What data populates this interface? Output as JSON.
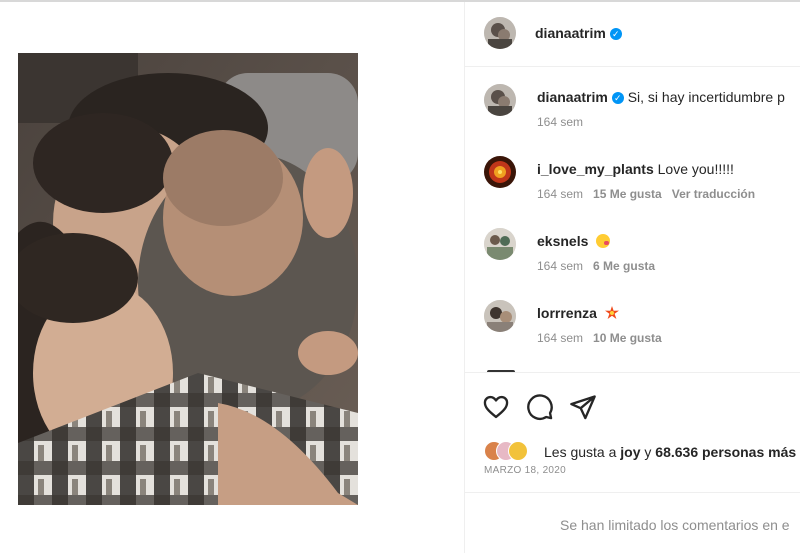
{
  "post": {
    "author": "dianaatrim",
    "verified": true
  },
  "comments": [
    {
      "user": "dianaatrim",
      "verified": true,
      "text": "Si, si hay incertidumbre p",
      "time": "164 sem",
      "likes": "",
      "translate": ""
    },
    {
      "user": "i_love_my_plants",
      "verified": false,
      "text": "Love you!!!!!",
      "time": "164 sem",
      "likes": "15 Me gusta",
      "translate": "Ver traducción"
    },
    {
      "user": "eksnels",
      "verified": false,
      "text": "",
      "emoji": "kiss-heart-emoji",
      "time": "164 sem",
      "likes": "6 Me gusta",
      "translate": ""
    },
    {
      "user": "lorrrenza",
      "verified": false,
      "text": "",
      "emoji": "sparkle-emoji",
      "time": "164 sem",
      "likes": "10 Me gusta",
      "translate": ""
    }
  ],
  "actions": {
    "like_icon": "heart-outline-icon",
    "comment_icon": "comment-bubble-icon",
    "share_icon": "paper-plane-icon"
  },
  "likes": {
    "prefix": "Les gusta a",
    "first_user": "joy",
    "connector": "y",
    "others": "68.636 personas más"
  },
  "date": "MARZO 18, 2020",
  "footer": {
    "limited_comments": "Se han limitado los comentarios en e"
  },
  "colors": {
    "verified": "#0095f6",
    "muted_text": "#8e8e8e",
    "divider": "#efefef"
  }
}
